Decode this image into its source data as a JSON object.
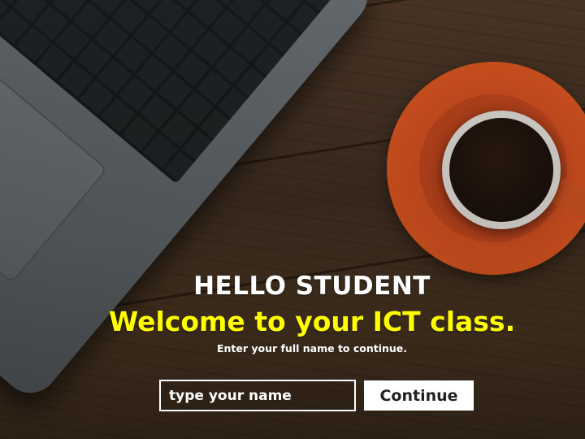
{
  "background": {
    "scene": "laptop and coffee cup on wooden desk"
  },
  "greeting": {
    "headline": "HELLO STUDENT",
    "welcome": "Welcome to your ICT class.",
    "instructions": "Enter your full name to continue."
  },
  "form": {
    "name_value": "",
    "name_placeholder": "type your name",
    "continue_label": "Continue"
  },
  "colors": {
    "headline": "#ffffff",
    "welcome": "#ffff00",
    "button_bg": "#ffffff",
    "saucer": "#c94c1e"
  }
}
